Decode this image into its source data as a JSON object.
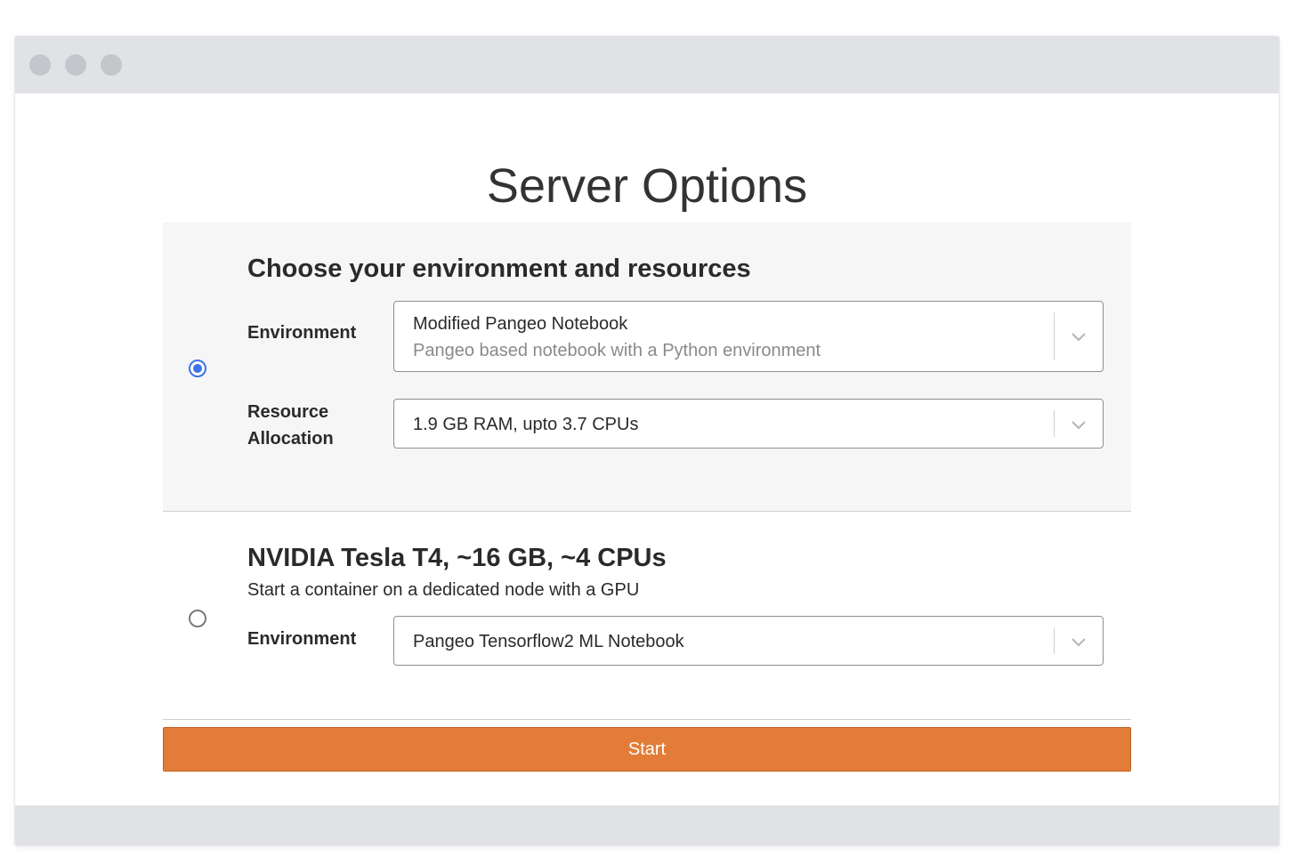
{
  "page": {
    "title": "Server Options"
  },
  "options": [
    {
      "selected": true,
      "heading": "Choose your environment and resources",
      "fields": [
        {
          "label_lines": [
            "Environment"
          ],
          "value": "Modified Pangeo Notebook",
          "description": "Pangeo based notebook with a Python environment"
        },
        {
          "label_lines": [
            "Resource",
            "Allocation"
          ],
          "value": "1.9 GB RAM, upto 3.7 CPUs"
        }
      ]
    },
    {
      "selected": false,
      "heading": "NVIDIA Tesla T4, ~16 GB, ~4 CPUs",
      "description": "Start a container on a dedicated node with a GPU",
      "fields": [
        {
          "label_lines": [
            "Environment"
          ],
          "value": "Pangeo Tensorflow2 ML Notebook"
        }
      ]
    }
  ],
  "start_button": {
    "label": "Start"
  },
  "colors": {
    "accent": "#e37c38",
    "radio_selected": "#3b73e8",
    "panel_selected_bg": "#f6f6f6",
    "window_chrome": "#e1e2e6"
  },
  "icons": {
    "dropdown": "chevron-down-icon",
    "window_controls": [
      "close-dot",
      "minimize-dot",
      "maximize-dot"
    ]
  }
}
